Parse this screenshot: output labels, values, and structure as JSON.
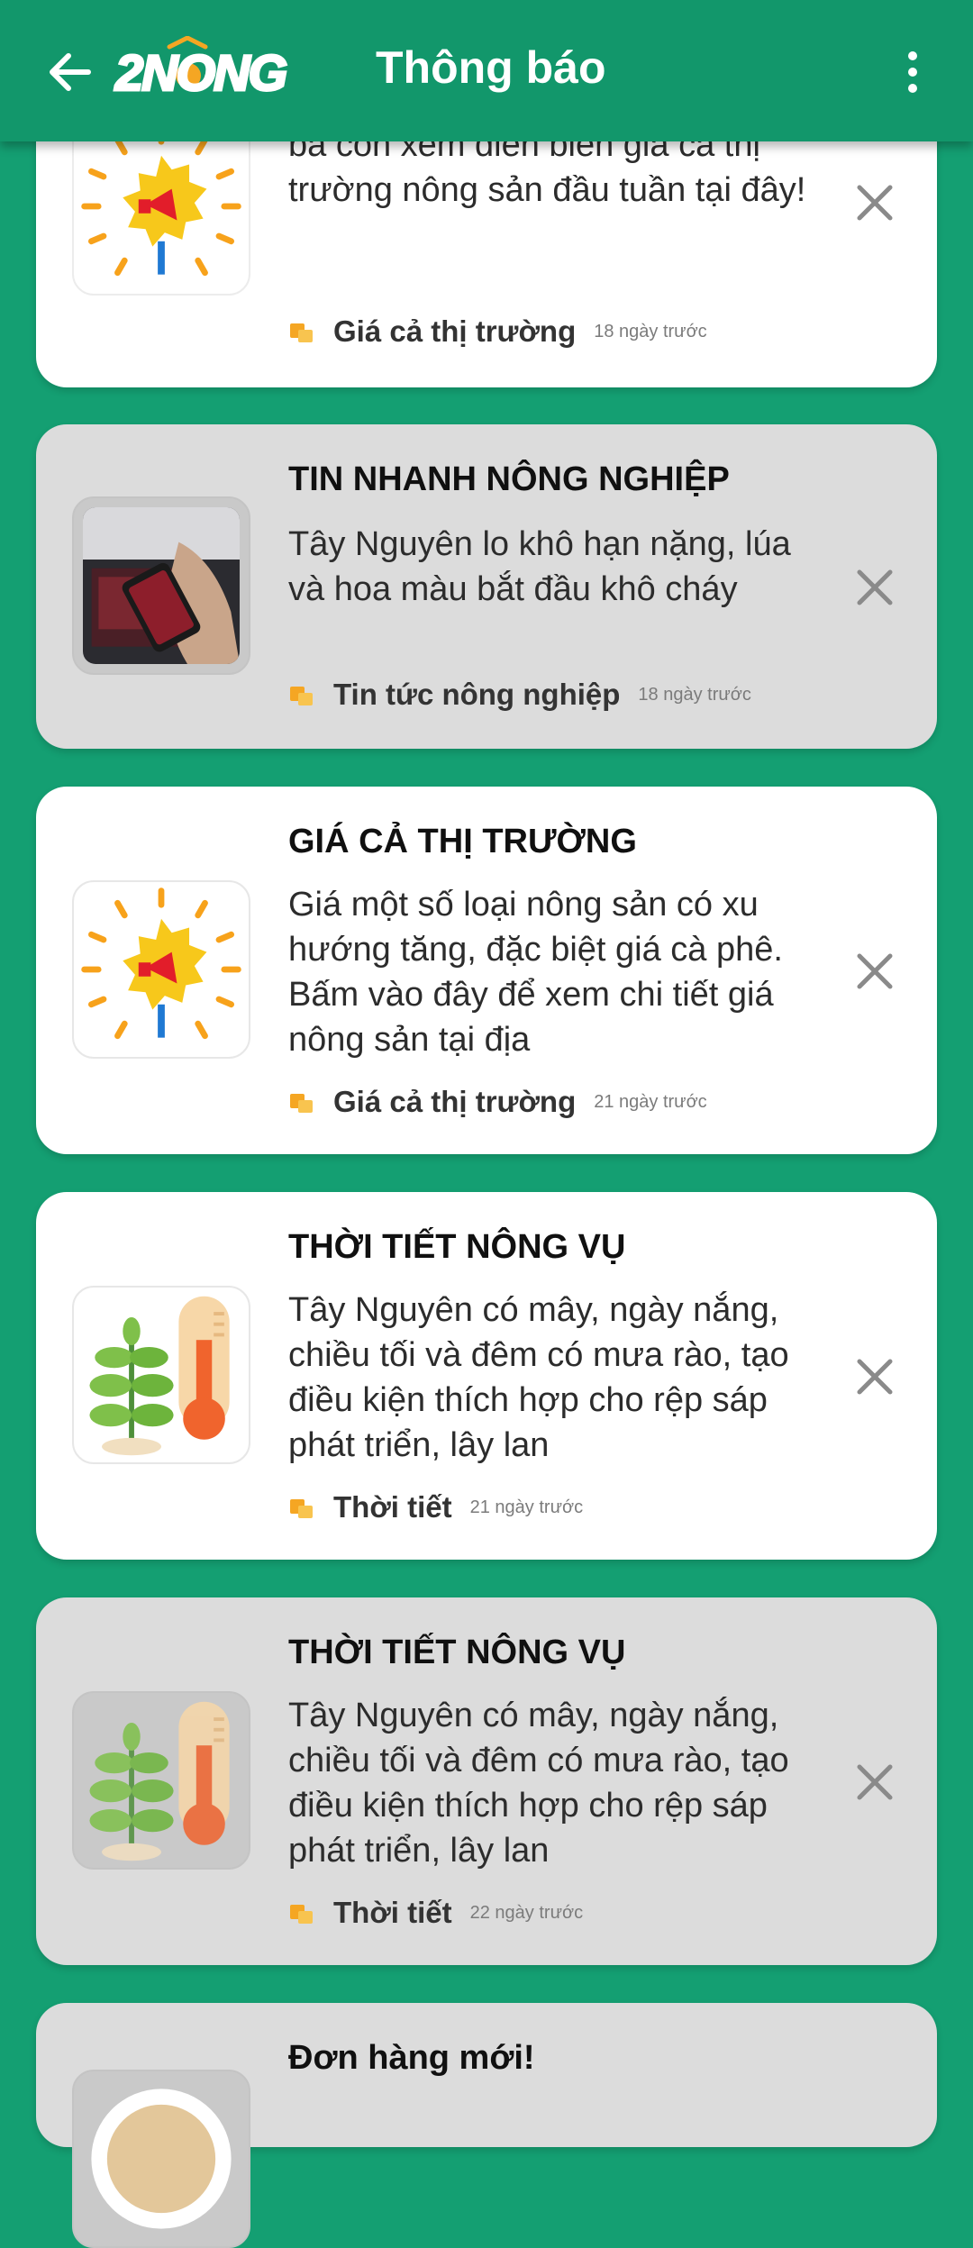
{
  "header": {
    "title": "Thông báo",
    "logo_text": "2NONG"
  },
  "notifications": [
    {
      "title": "",
      "body": "Giá lúa hôm nay sụt nhẹ, mời quý bà con xem diễn biến giá cả thị trường nông sản đầu tuần tại đây!",
      "category": "Giá cả thị trường",
      "time": "18 ngày trước",
      "icon": "market-price-icon",
      "read": false
    },
    {
      "title": "TIN NHANH NÔNG NGHIỆP",
      "body": "Tây Nguyên lo khô hạn nặng, lúa và hoa màu bắt đầu khô cháy",
      "category": "Tin tức nông nghiệp",
      "time": "18 ngày trước",
      "icon": "news-photo",
      "read": true
    },
    {
      "title": "GIÁ CẢ THỊ TRƯỜNG",
      "body": "Giá một số loại nông sản có xu hướng tăng, đặc biệt giá cà phê. Bấm vào đây để xem chi tiết giá nông sản tại địa",
      "category": "Giá cả thị trường",
      "time": "21 ngày trước",
      "icon": "market-price-icon",
      "read": false
    },
    {
      "title": "THỜI TIẾT NÔNG VỤ",
      "body": "Tây Nguyên có mây, ngày nắng, chiều tối và đêm có mưa rào, tạo điều kiện thích hợp cho rệp sáp phát triển, lây lan",
      "category": "Thời tiết",
      "time": "21 ngày trước",
      "icon": "weather-plant-icon",
      "read": false
    },
    {
      "title": "THỜI TIẾT NÔNG VỤ",
      "body": "Tây Nguyên có mây, ngày nắng, chiều tối và đêm có mưa rào, tạo điều kiện thích hợp cho rệp sáp phát triển, lây lan",
      "category": "Thời tiết",
      "time": "22 ngày trước",
      "icon": "weather-plant-icon",
      "read": true
    },
    {
      "title": "Đơn hàng mới!",
      "body": "",
      "category": "",
      "time": "",
      "icon": "order-icon",
      "read": true
    }
  ],
  "colors": {
    "background": "#149f72",
    "header": "#12976b",
    "card_unread": "#ffffff",
    "card_read": "#dcdcdc",
    "accent_orange": "#f5a623"
  }
}
